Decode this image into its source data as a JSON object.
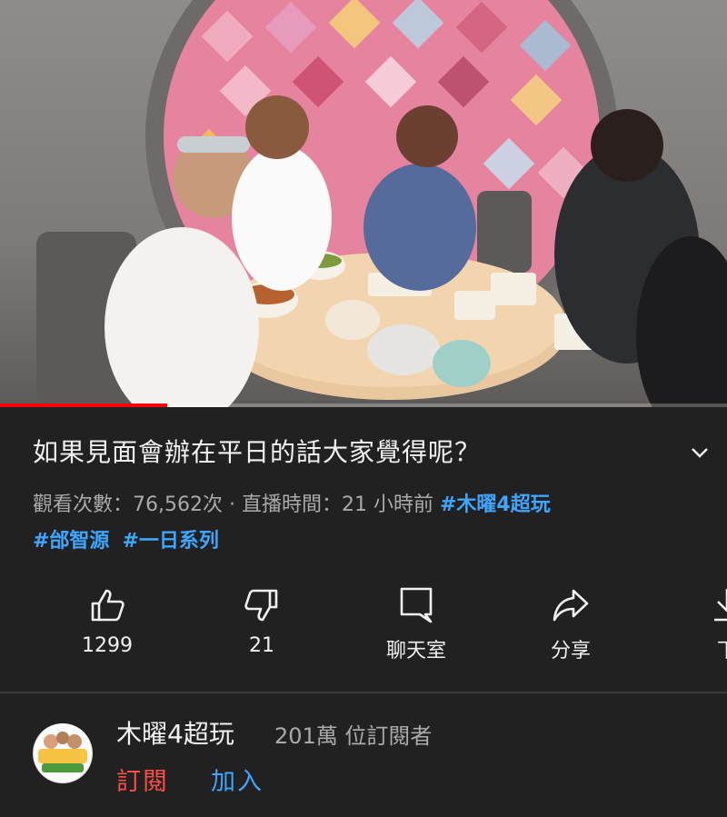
{
  "video": {
    "thumbnail_icon": "video-frame",
    "progress_fraction": 0.23
  },
  "title": "如果見面會辦在平日的話大家覺得呢？",
  "meta": {
    "views": "觀看次數：76,562次",
    "separator": "·",
    "stream_time": "直播時間：21 小時前",
    "hashtags": [
      "#木曜4超玩",
      "#邰智源",
      "#一日系列"
    ]
  },
  "actions": [
    {
      "icon": "thumbs-up-icon",
      "label": "1299"
    },
    {
      "icon": "thumbs-down-icon",
      "label": "21"
    },
    {
      "icon": "chat-icon",
      "label": "聊天室"
    },
    {
      "icon": "share-icon",
      "label": "分享"
    },
    {
      "icon": "download-icon",
      "label": "下"
    }
  ],
  "channel": {
    "name": "木曜4超玩",
    "subscribers": "201萬 位訂閱者",
    "subscribe_label": "訂閱",
    "join_label": "加入",
    "avatar_text": "木曜4超玩"
  },
  "colors": {
    "background": "#212121",
    "progress": "#ff0000",
    "hashtag": "#3ea6ff",
    "subscribe": "#ff4e45",
    "join": "#3ea6ff"
  }
}
